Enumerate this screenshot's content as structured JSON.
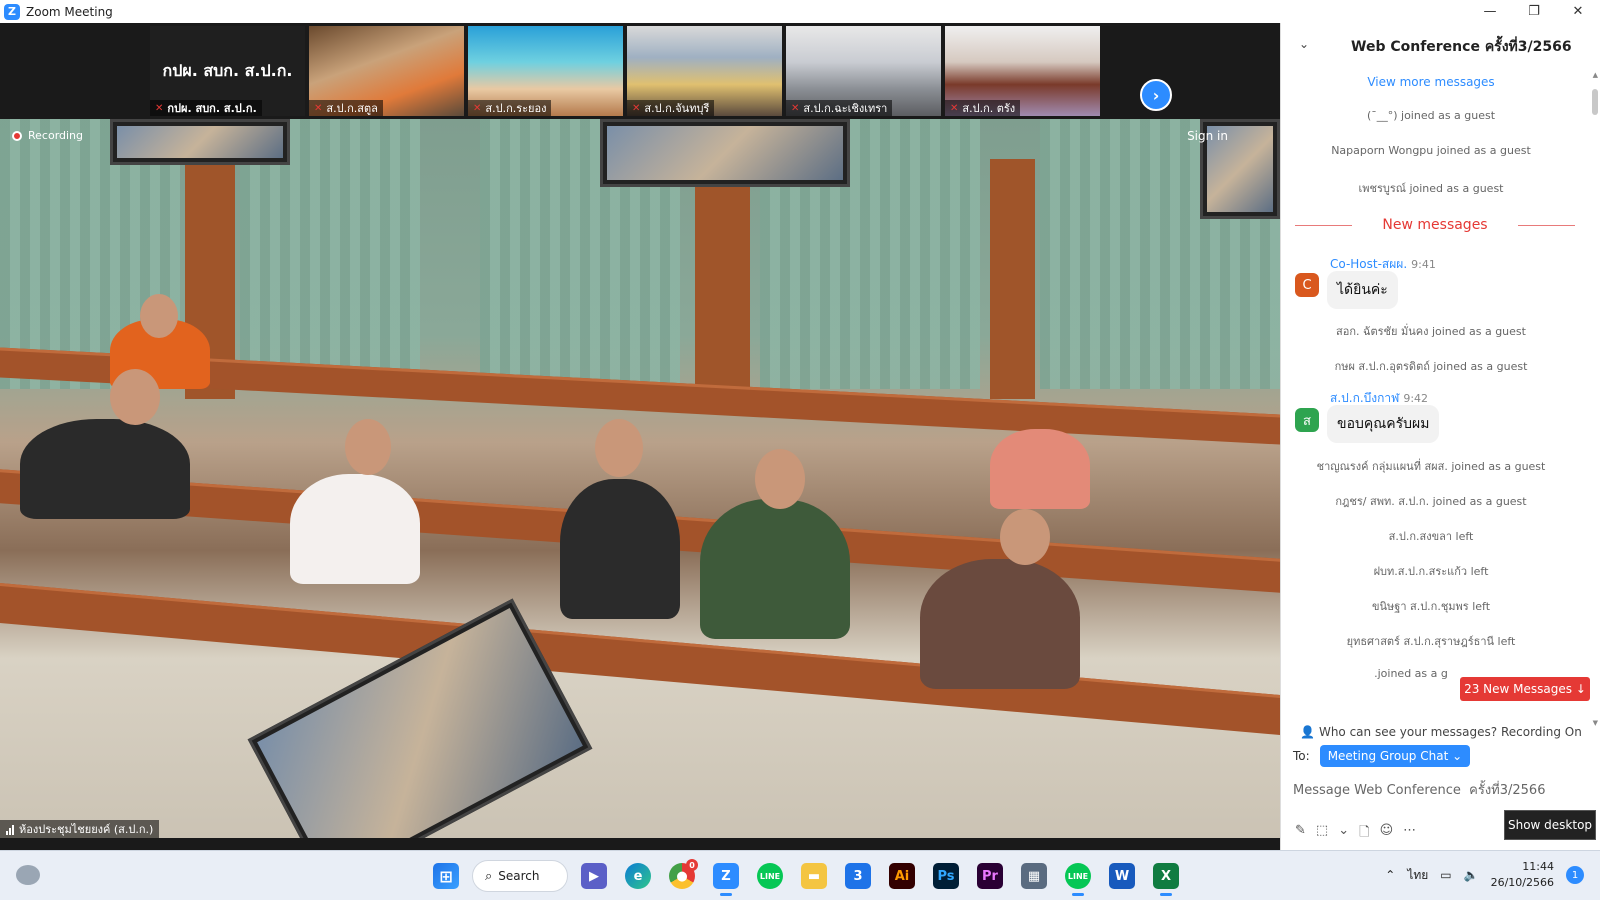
{
  "window": {
    "title": "Zoom Meeting",
    "logo_letter": "Z",
    "controls": {
      "minimize": "—",
      "maximize": "❐",
      "close": "✕"
    }
  },
  "thumbnails": [
    {
      "name": "กปผ. สบก. ส.ป.ก.",
      "display_text": "กปผ. สบก. ส.ป.ก."
    },
    {
      "name": "ส.ป.ก.สตูล"
    },
    {
      "name": "ส.ป.ก.ระยอง"
    },
    {
      "name": "ส.ป.ก.จันทบุรี"
    },
    {
      "name": "ส.ป.ก.ฉะเชิงเทรา"
    },
    {
      "name": "ส.ป.ก. ตรัง"
    }
  ],
  "main_video": {
    "recording_label": "Recording",
    "signin_text": "Sign in",
    "speaker_name": "ห้องประชุมไชยยงค์ (ส.ป.ก.)"
  },
  "chat": {
    "title": "Web Conference  ครั้งที่3/2566",
    "view_more": "View more messages",
    "messages_top": [
      "(¯__°) joined as a guest",
      "Napaporn Wongpu joined as a guest",
      "เพชรบูรณ์ joined as a guest"
    ],
    "new_messages_divider": "New messages",
    "msg1": {
      "sender": "Co-Host-สผผ.",
      "time": "9:41",
      "avatar": "C",
      "avatar_color": "#d9581e",
      "text": "ได้ยินค่ะ"
    },
    "messages_mid": [
      "สอก. ฉัตรชัย มั่นคง joined as a guest",
      "กษผ ส.ป.ก.อุตรดิตถ์ joined as a guest"
    ],
    "msg2": {
      "sender": "ส.ป.ก.บึงกาฬ",
      "time": "9:42",
      "avatar": "ส",
      "avatar_color": "#2ea44f",
      "text": "ขอบคุณครับผม"
    },
    "messages_bottom": [
      "ชาญณรงค์ กลุ่มแผนที่ สผส. joined as a guest",
      "กฎชร/ สพท. ส.ป.ก. joined as a guest",
      "ส.ป.ก.สงขลา left",
      "ฝบท.ส.ป.ก.สระแก้ว left",
      "ขนิษฐา ส.ป.ก.ชุมพร left",
      "ยุทธศาสตร์ ส.ป.ก.สุราษฎร์ธานี left",
      ".joined as a g"
    ],
    "new_messages_pill": "23 New Messages ↓",
    "privacy_text": "Who can see your messages? Recording On",
    "to_label": "To:",
    "to_value": "Meeting Group Chat ⌄",
    "input_placeholder": "Message Web Conference  ครั้งที่3/2566",
    "show_desktop": "Show desktop"
  },
  "taskbar": {
    "search_label": "Search",
    "apps": [
      "start",
      "search",
      "meet",
      "edge",
      "chrome",
      "zoom",
      "line",
      "explorer",
      "app3",
      "illustrator",
      "photoshop",
      "premiere",
      "calculator",
      "line2",
      "word",
      "excel"
    ],
    "app_labels": {
      "chrome_badge": "0",
      "app3": "3",
      "illustrator": "Ai",
      "photoshop": "Ps",
      "premiere": "Pr"
    },
    "language": "ไทย",
    "time": "11:44",
    "date": "26/10/2566",
    "notification_count": "1"
  }
}
